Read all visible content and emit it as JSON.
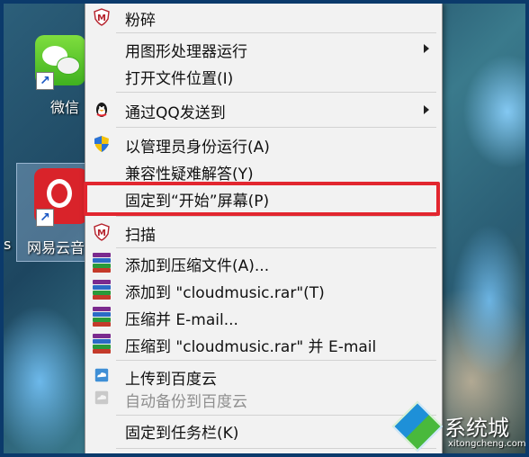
{
  "desktop": {
    "wechat_label": "微信",
    "netease_label": "网易云音",
    "left_edge_text": "s"
  },
  "menu": {
    "items": [
      {
        "label": "粉碎",
        "icon": "shield-m-icon"
      },
      {
        "label": "用图形处理器运行",
        "submenu": true
      },
      {
        "label": "打开文件位置(I)"
      },
      {
        "label": "通过QQ发送到",
        "icon": "qq-penguin-icon",
        "submenu": true
      },
      {
        "label": "以管理员身份运行(A)",
        "icon": "uac-shield-icon"
      },
      {
        "label": "兼容性疑难解答(Y)"
      },
      {
        "label": "固定到“开始”屏幕(P)",
        "highlighted": true
      },
      {
        "label": "扫描",
        "icon": "shield-m-icon"
      },
      {
        "label": "添加到压缩文件(A)...",
        "icon": "winrar-icon"
      },
      {
        "label": "添加到 \"cloudmusic.rar\"(T)",
        "icon": "winrar-icon"
      },
      {
        "label": "压缩并 E-mail...",
        "icon": "winrar-icon"
      },
      {
        "label": "压缩到 \"cloudmusic.rar\" 并 E-mail",
        "icon": "winrar-icon"
      },
      {
        "label": "上传到百度云",
        "icon": "baidu-cloud-icon"
      },
      {
        "label": "自动备份到百度云",
        "icon": "baidu-cloud-icon",
        "disabled": true
      },
      {
        "label": "固定到任务栏(K)"
      }
    ]
  },
  "watermark": {
    "brand": "系统城",
    "url": "xitongcheng.com"
  },
  "colors": {
    "highlight_border": "#e2262f",
    "menu_bg": "#f2f2f2",
    "frame_border": "#0b3a6b"
  }
}
